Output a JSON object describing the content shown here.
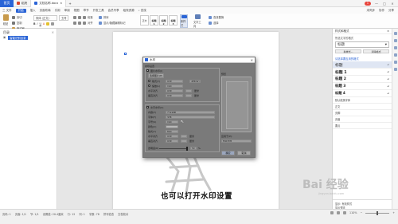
{
  "titlebar": {
    "home_label": "首页",
    "tabs": [
      {
        "label": "稻壳",
        "active": false,
        "color": "#d9452c"
      },
      {
        "label": "文档名称.docx",
        "active": true,
        "color": "#2a64d6"
      }
    ],
    "badge": "1",
    "minimize": "—",
    "maximize": "□",
    "close": "×"
  },
  "menubar": {
    "file": "三 文件",
    "items": [
      "开始",
      "插入",
      "页面布局",
      "引用",
      "审阅",
      "视图",
      "章节",
      "开发工具",
      "会员专享",
      "稻壳资源"
    ],
    "active_item": "开始",
    "search": "查找",
    "right": [
      "未同步",
      "协作",
      "分享"
    ]
  },
  "ribbon": {
    "paste": "粘贴",
    "group1": [
      "剪切",
      "复制",
      "格式刷"
    ],
    "group2": [
      "宋体 (正文)",
      "五号"
    ],
    "group3": [
      "B",
      "I",
      "U",
      "A"
    ],
    "group4": [
      "段落",
      "对齐"
    ],
    "styles": [
      "正文",
      "标题 1",
      "标题 2",
      "标题 3"
    ],
    "new_style": "新样式",
    "find_replace": [
      "查找替换",
      "选择"
    ],
    "text_tools": "文字工具",
    "sort": [
      "排序",
      "显示/隐藏编辑标记"
    ]
  },
  "leftnav": {
    "title": "目录",
    "close": "×",
    "tools": [
      "智能识别目录",
      "▣"
    ]
  },
  "document": {
    "title": "总完经验",
    "caption": "也可以打开水印设置",
    "watermark_color": "#c8c8c8"
  },
  "dialog": {
    "title": "水印",
    "close": "×",
    "section_watermark": "水印设置",
    "picture_watermark": "图片水印(I)",
    "select_picture": "选择图片(P)",
    "scale_label": "缩放(L)",
    "scale_value": "自动",
    "washout_label": "冲蚀(W)",
    "rows": [
      {
        "label": "版式(Y)",
        "value": "居中"
      },
      {
        "label": "水平对齐",
        "value": "居中"
      },
      {
        "label": "垂直对齐",
        "value": "居中"
      }
    ],
    "unit": "厘米",
    "text_watermark": "文字水印(X)",
    "content_label": "内容(T)",
    "content_value": "严禁复制",
    "font_label": "字体(F)",
    "font_value": "宋体",
    "size_label": "字号(S)",
    "size_value": "自动",
    "color_label": "颜色(C)",
    "layout_label": "版式(Y)",
    "layout_value": "倾斜",
    "h_align_label": "水平对齐",
    "v_align_label": "垂直对齐",
    "opacity_label": "透明度(R)",
    "opacity_value": "50",
    "percent": "%",
    "preview_label": "预览",
    "apply_label": "应用于(P):",
    "apply_value": "整篇文档",
    "ok": "确定",
    "cancel": "取消"
  },
  "rightpanel": {
    "header": "样式和格式",
    "close": "×",
    "current_label": "所选文字的格式",
    "current_value": "标题",
    "new_style": "新样式...",
    "clear": "清除格式",
    "section": "请选择要应用的格式",
    "styles": [
      "标题",
      "标题 1",
      "标题 2",
      "标题 3",
      "标题 4"
    ],
    "small_styles": [
      "默认段落字体",
      "正文",
      "页脚",
      "页眉",
      "要点"
    ],
    "footer_show": "显示: 有效样式",
    "footer_preview": "显示预览"
  },
  "statusbar": {
    "items": [
      "页码: 1",
      "页面: 1/1",
      "节: 1/1",
      "设置值: 20.4厘米",
      "行: 12",
      "列: 1",
      "字数: 78",
      "拼写检查",
      "文档校对"
    ],
    "zoom": "110%",
    "zoom_level": 0.5,
    "watermark": "Bai 经验",
    "watermark_sub": "jingyan.baidu.com"
  }
}
